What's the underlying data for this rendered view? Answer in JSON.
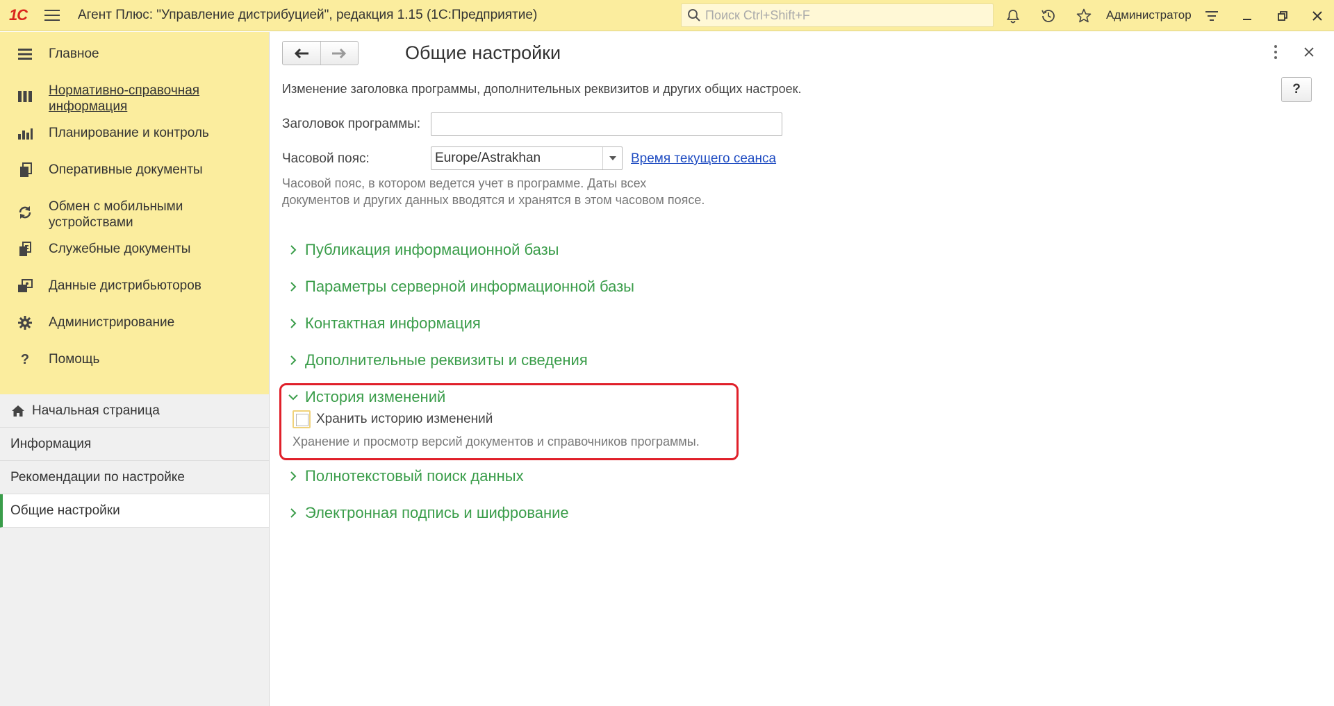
{
  "app": {
    "logo_text": "1С",
    "title": "Агент Плюс: \"Управление дистрибуцией\", редакция 1.15  (1С:Предприятие)",
    "search_placeholder": "Поиск Ctrl+Shift+F",
    "user": "Администратор"
  },
  "sidebar": {
    "sections": [
      {
        "label": "Главное",
        "icon": "menu-lines-icon"
      },
      {
        "label": "Нормативно-справочная информация",
        "icon": "reference-icon"
      },
      {
        "label": "Планирование и контроль",
        "icon": "chart-icon"
      },
      {
        "label": "Оперативные документы",
        "icon": "documents-icon"
      },
      {
        "label": "Обмен с мобильными устройствами",
        "icon": "sync-icon"
      },
      {
        "label": "Служебные документы",
        "icon": "service-docs-icon"
      },
      {
        "label": "Данные дистрибьюторов",
        "icon": "distributors-icon"
      },
      {
        "label": "Администрирование",
        "icon": "gear-icon"
      },
      {
        "label": "Помощь",
        "icon": "question-icon"
      }
    ],
    "nav": [
      {
        "label": "Начальная страница"
      },
      {
        "label": "Информация"
      },
      {
        "label": "Рекомендации по настройке"
      },
      {
        "label": "Общие настройки"
      }
    ]
  },
  "form": {
    "title": "Общие настройки",
    "help_label": "?",
    "description": "Изменение заголовка программы, дополнительных реквизитов и других общих настроек.",
    "program_title_label": "Заголовок программы:",
    "program_title_value": "",
    "timezone_label": "Часовой пояс:",
    "timezone_value": "Europe/Astrakhan",
    "session_time_link": "Время текущего сеанса",
    "timezone_hint": "Часовой пояс, в котором ведется учет в программе. Даты всех документов и других данных вводятся и хранятся в этом часовом поясе.",
    "groups_top": [
      {
        "title": "Публикация информационной базы"
      },
      {
        "title": "Параметры серверной информационной базы"
      },
      {
        "title": "Контактная информация"
      },
      {
        "title": "Дополнительные реквизиты и сведения"
      }
    ],
    "history": {
      "title": "История изменений",
      "checkbox_label": "Хранить историю изменений",
      "checked": false,
      "hint": "Хранение и просмотр версий документов и справочников программы."
    },
    "groups_bottom": [
      {
        "title": "Полнотекстовый поиск данных"
      },
      {
        "title": "Электронная подпись и шифрование"
      }
    ]
  },
  "colors": {
    "titlebar": "#fbed9e",
    "accent_green": "#3a9d4a",
    "highlight_red": "#e0202a",
    "link_blue": "#1f4cc2"
  }
}
